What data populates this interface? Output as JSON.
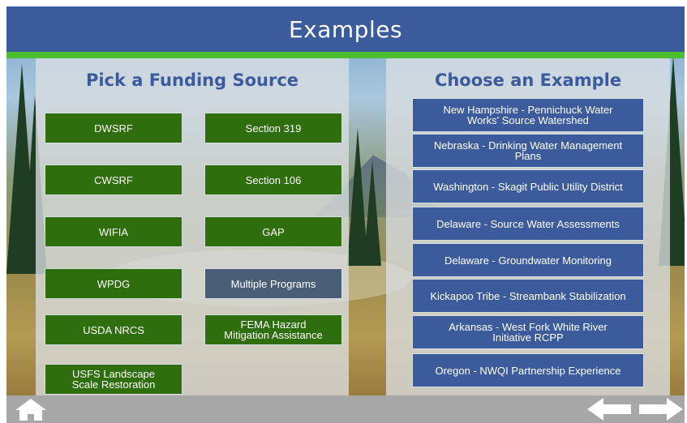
{
  "header": {
    "title": "Examples"
  },
  "left_panel": {
    "title": "Pick a Funding Source",
    "buttons": [
      "DWSRF",
      "Section 319",
      "CWSRF",
      "Section 106",
      "WIFIA",
      "GAP",
      "WPDG",
      "Multiple Programs",
      "USDA NRCS",
      "FEMA Hazard\nMitigation Assistance",
      "USFS Landscape\nScale Restoration"
    ]
  },
  "right_panel": {
    "title": "Choose an Example",
    "buttons": [
      "New Hampshire - Pennichuck Water\nWorks' Source Watershed",
      "Nebraska - Drinking Water Management\nPlans",
      "Washington - Skagit Public Utility District",
      "Delaware - Source Water Assessments",
      "Delaware - Groundwater Monitoring",
      "Kickapoo Tribe - Streambank Stabilization",
      "Arkansas - West Fork White River\nInitiative RCPP",
      "Oregon - NWQI Partnership Experience"
    ]
  },
  "footer": {
    "home_icon": "home-icon",
    "back_icon": "arrow-left-icon",
    "forward_icon": "arrow-right-icon"
  },
  "colors": {
    "header_blue": "#3b5b9c",
    "accent_green": "#4cbf2f",
    "fund_button_green": "#2e6e0d",
    "multiple_programs_gray": "#4b5e78",
    "footer_gray": "#a7a7a7"
  }
}
